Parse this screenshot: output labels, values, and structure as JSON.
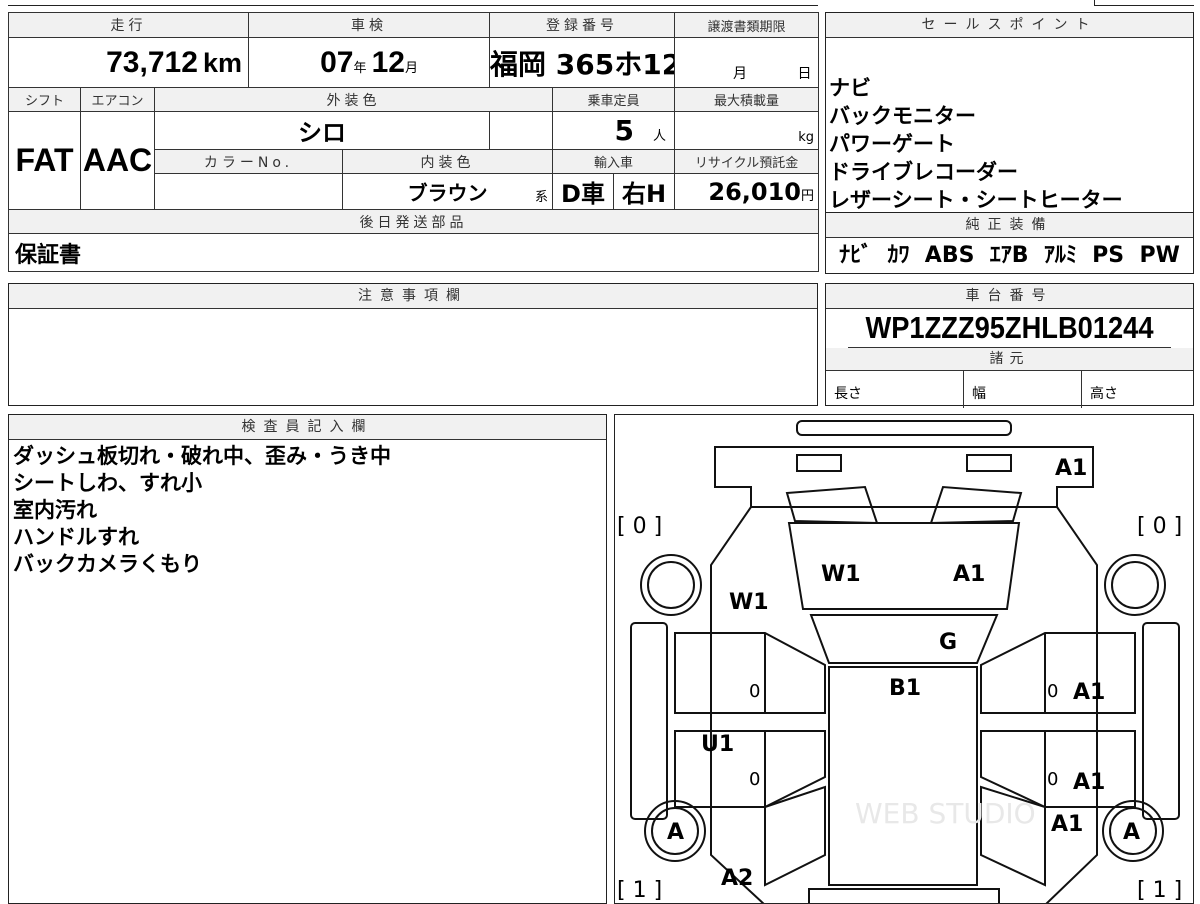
{
  "mileage": {
    "label": "走行",
    "value": "73,712",
    "unit": "km"
  },
  "inspection": {
    "label": "車検",
    "year": "07",
    "year_unit": "年",
    "month": "12",
    "month_unit": "月"
  },
  "registration": {
    "label": "登録番号",
    "value": "福岡 365ホ12"
  },
  "transfer": {
    "label": "譲渡書類期限",
    "month_unit": "月",
    "day_unit": "日"
  },
  "shift": {
    "label": "シフト",
    "value": "FAT"
  },
  "aircon": {
    "label": "エアコン",
    "value": "AAC"
  },
  "exterior": {
    "label": "外装色",
    "value": "シロ"
  },
  "color_no": {
    "label": "カラーNo."
  },
  "interior": {
    "label": "内装色",
    "value": "ブラウン",
    "suffix": "系"
  },
  "capacity": {
    "label": "乗車定員",
    "value": "5",
    "unit": "人"
  },
  "max_load": {
    "label": "最大積載量",
    "unit": "kg"
  },
  "import": {
    "label": "輸入車",
    "dealer": "D車",
    "handle": "右H"
  },
  "recycle": {
    "label": "リサイクル預託金",
    "value": "26,010",
    "unit": "円"
  },
  "later_parts": {
    "label": "後日発送部品",
    "value": "保証書"
  },
  "notes": {
    "label": "注意事項欄"
  },
  "sales_points": {
    "label": "セールスポイント",
    "items": [
      "ナビ",
      "バックモニター",
      "パワーゲート",
      "ドライブレコーダー",
      "レザーシート・シートヒーター"
    ]
  },
  "genuine": {
    "label": "純正装備",
    "value": "ﾅﾋﾞ  ｶﾜ  ABS  ｴｱB  ｱﾙﾐ  PS  PW"
  },
  "chassis": {
    "label": "車台番号",
    "value": "WP1ZZZ95ZHLB01244"
  },
  "specs": {
    "label": "諸元",
    "length": "長さ",
    "width": "幅",
    "height": "高さ"
  },
  "inspector": {
    "label": "検査員記入欄",
    "items": [
      "ダッシュ板切れ・破れ中、歪み・うき中",
      "シートしわ、すれ小",
      "室内汚れ",
      "ハンドルすれ",
      "バックカメラくもり"
    ]
  },
  "diagram": {
    "marks": {
      "rear_a1": "A1",
      "rear_left_bracket": "[ 0 ]",
      "rear_right_bracket": "[ 0 ]",
      "glass_w1": "W1",
      "glass_a1": "A1",
      "side_w1": "W1",
      "hood_g": "G",
      "roof_b1": "B1",
      "left_zero_1": "0",
      "right_zero_1": "0",
      "right_a1_1": "A1",
      "left_u1": "U1",
      "left_zero_2": "0",
      "right_zero_2": "0",
      "right_a1_2": "A1",
      "front_right_a1": "A1",
      "tire_left": "A",
      "tire_right": "A",
      "front_a2": "A2",
      "front_left_bracket": "[ 1 ]",
      "front_right_bracket": "[ 1 ]"
    },
    "watermark": "WEB STUDIO"
  }
}
